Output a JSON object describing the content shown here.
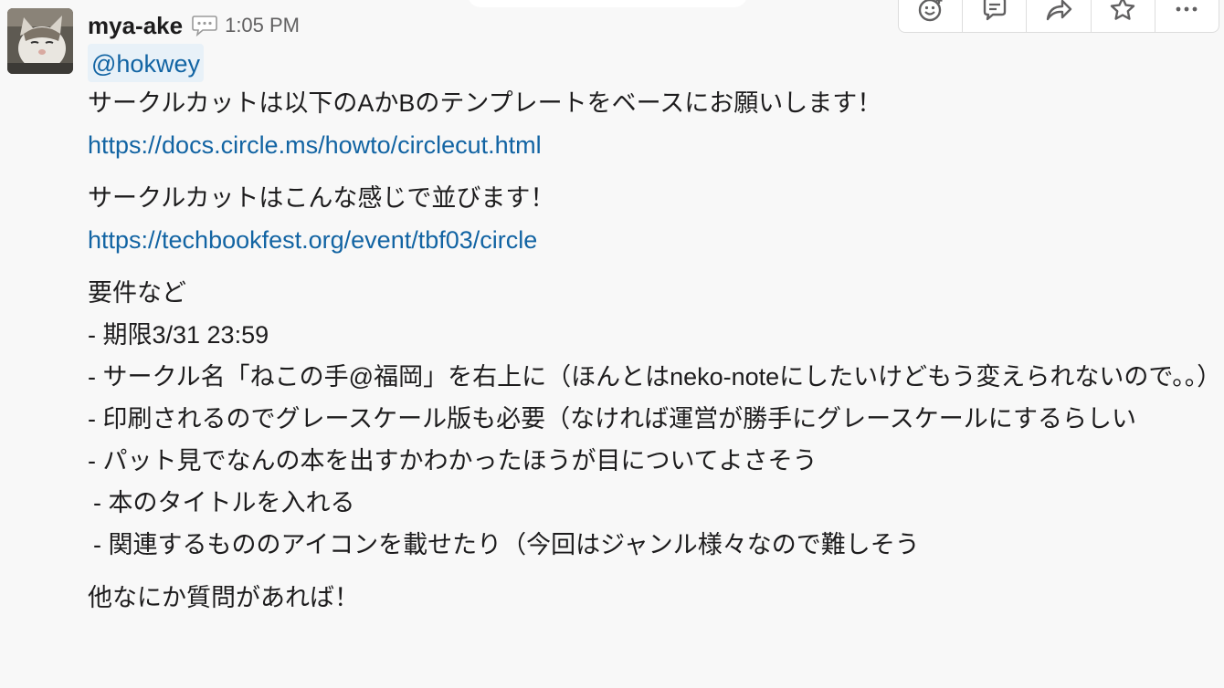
{
  "message": {
    "username": "mya-ake",
    "timestamp": "1:05 PM",
    "mention": "@hokwey",
    "lines": {
      "l1": "サークルカットは以下のAかBのテンプレートをベースにお願いします！",
      "link1": "https://docs.circle.ms/howto/circlecut.html",
      "l2": "サークルカットはこんな感じで並びます！",
      "link2": "https://techbookfest.org/event/tbf03/circle",
      "l3": "要件など",
      "l4": "- 期限3/31 23:59",
      "l5": "- サークル名「ねこの手@福岡」を右上に（ほんとはneko-noteにしたいけどもう変えられないので。。）",
      "l6": "- 印刷されるのでグレースケール版も必要（なければ運営が勝手にグレースケールにするらしい",
      "l7": "- パット見でなんの本を出すかわかったほうが目についてよさそう",
      "l8": " - 本のタイトルを入れる",
      "l9": " - 関連するもののアイコンを載せたり（今回はジャンル様々なので難しそう",
      "l10": "他なにか質問があれば！"
    }
  },
  "toolbar": {
    "icons": [
      "emoji-icon",
      "thread-reply-icon",
      "share-icon",
      "star-icon",
      "more-icon"
    ]
  },
  "colors": {
    "link": "#1264a3",
    "background": "#f8f8f8",
    "text": "#1d1c1d",
    "timestamp": "#616061"
  }
}
